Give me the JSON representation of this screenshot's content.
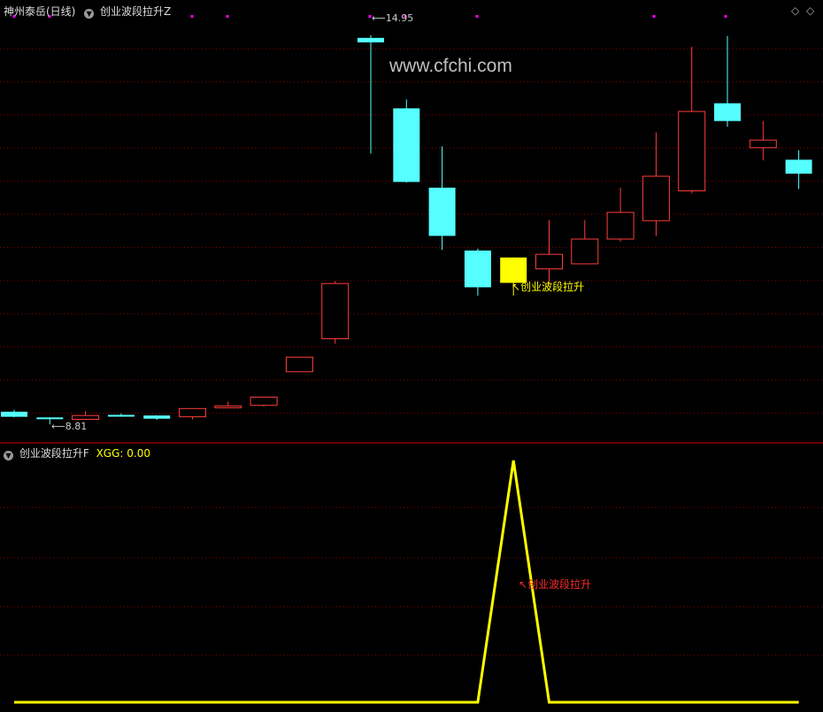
{
  "top_panel": {
    "stock_label": "神州泰岳(日线)",
    "indicator_label": "创业波段拉升Z",
    "high_label": "14.95",
    "low_label": "8.81",
    "signal_label": "创业波段拉升"
  },
  "bottom_panel": {
    "indicator_label": "创业波段拉升F",
    "xgg_label": "XGG: 0.00",
    "signal_label": "创业波段拉升"
  },
  "watermark": "www.cfchi.com",
  "colors": {
    "up": "#ff3c3c",
    "down": "#55ffff",
    "signal": "#ffff00",
    "grid": "#8b0000",
    "marker": "#ff00ff"
  },
  "chart_data": [
    {
      "type": "candlestick",
      "title": "神州泰岳(日线)",
      "annotations": [
        {
          "text": "14.95",
          "meaning": "high"
        },
        {
          "text": "8.81",
          "meaning": "low"
        },
        {
          "text": "创业波段拉升",
          "meaning": "signal"
        }
      ],
      "candles": [
        {
          "open": 9.02,
          "high": 9.05,
          "low": 8.93,
          "close": 8.94,
          "dir": "down"
        },
        {
          "open": 8.93,
          "high": 8.93,
          "low": 8.82,
          "close": 8.92,
          "dir": "down"
        },
        {
          "open": 8.9,
          "high": 9.03,
          "low": 8.89,
          "close": 8.96,
          "dir": "up"
        },
        {
          "open": 8.97,
          "high": 8.99,
          "low": 8.94,
          "close": 8.96,
          "dir": "down"
        },
        {
          "open": 8.96,
          "high": 8.96,
          "low": 8.89,
          "close": 8.91,
          "dir": "down"
        },
        {
          "open": 8.94,
          "high": 9.07,
          "low": 8.9,
          "close": 9.07,
          "dir": "up"
        },
        {
          "open": 9.1,
          "high": 9.18,
          "low": 9.1,
          "close": 9.11,
          "dir": "up"
        },
        {
          "open": 9.12,
          "high": 9.26,
          "low": 9.1,
          "close": 9.25,
          "dir": "up"
        },
        {
          "open": 9.65,
          "high": 9.8,
          "low": 9.65,
          "close": 9.88,
          "dir": "up"
        },
        {
          "open": 10.17,
          "high": 11.08,
          "low": 10.09,
          "close": 11.04,
          "dir": "up"
        },
        {
          "open": 14.91,
          "high": 14.95,
          "low": 13.09,
          "close": 14.84,
          "dir": "down"
        },
        {
          "open": 13.8,
          "high": 13.94,
          "low": 12.63,
          "close": 12.64,
          "dir": "down"
        },
        {
          "open": 12.55,
          "high": 13.2,
          "low": 11.57,
          "close": 11.79,
          "dir": "down"
        },
        {
          "open": 11.56,
          "high": 11.59,
          "low": 10.85,
          "close": 10.98,
          "dir": "down"
        },
        {
          "open": 11.45,
          "high": 11.45,
          "low": 10.85,
          "close": 11.05,
          "dir": "signal"
        },
        {
          "open": 11.27,
          "high": 12.04,
          "low": 11.02,
          "close": 11.5,
          "dir": "up"
        },
        {
          "open": 11.35,
          "high": 12.04,
          "low": 11.35,
          "close": 11.74,
          "dir": "up"
        },
        {
          "open": 11.74,
          "high": 12.55,
          "low": 11.7,
          "close": 12.16,
          "dir": "up"
        },
        {
          "open": 12.03,
          "high": 13.42,
          "low": 11.79,
          "close": 12.73,
          "dir": "up"
        },
        {
          "open": 12.5,
          "high": 14.77,
          "low": 12.46,
          "close": 13.75,
          "dir": "up"
        },
        {
          "open": 13.88,
          "high": 14.94,
          "low": 13.51,
          "close": 13.6,
          "dir": "down"
        },
        {
          "open": 13.3,
          "high": 13.6,
          "low": 12.98,
          "close": 13.18,
          "dir": "up"
        },
        {
          "open": 12.99,
          "high": 13.14,
          "low": 12.53,
          "close": 12.77,
          "dir": "down"
        }
      ],
      "ylim": [
        8.6,
        15.2
      ]
    },
    {
      "type": "line",
      "title": "创业波段拉升F",
      "series": [
        {
          "name": "XGG",
          "values": [
            0,
            0,
            0,
            0,
            0,
            0,
            0,
            0,
            0,
            0,
            0,
            0,
            0,
            0,
            1,
            0,
            0,
            0,
            0,
            0,
            0,
            0,
            0
          ]
        }
      ],
      "ylim": [
        0,
        1
      ]
    }
  ]
}
